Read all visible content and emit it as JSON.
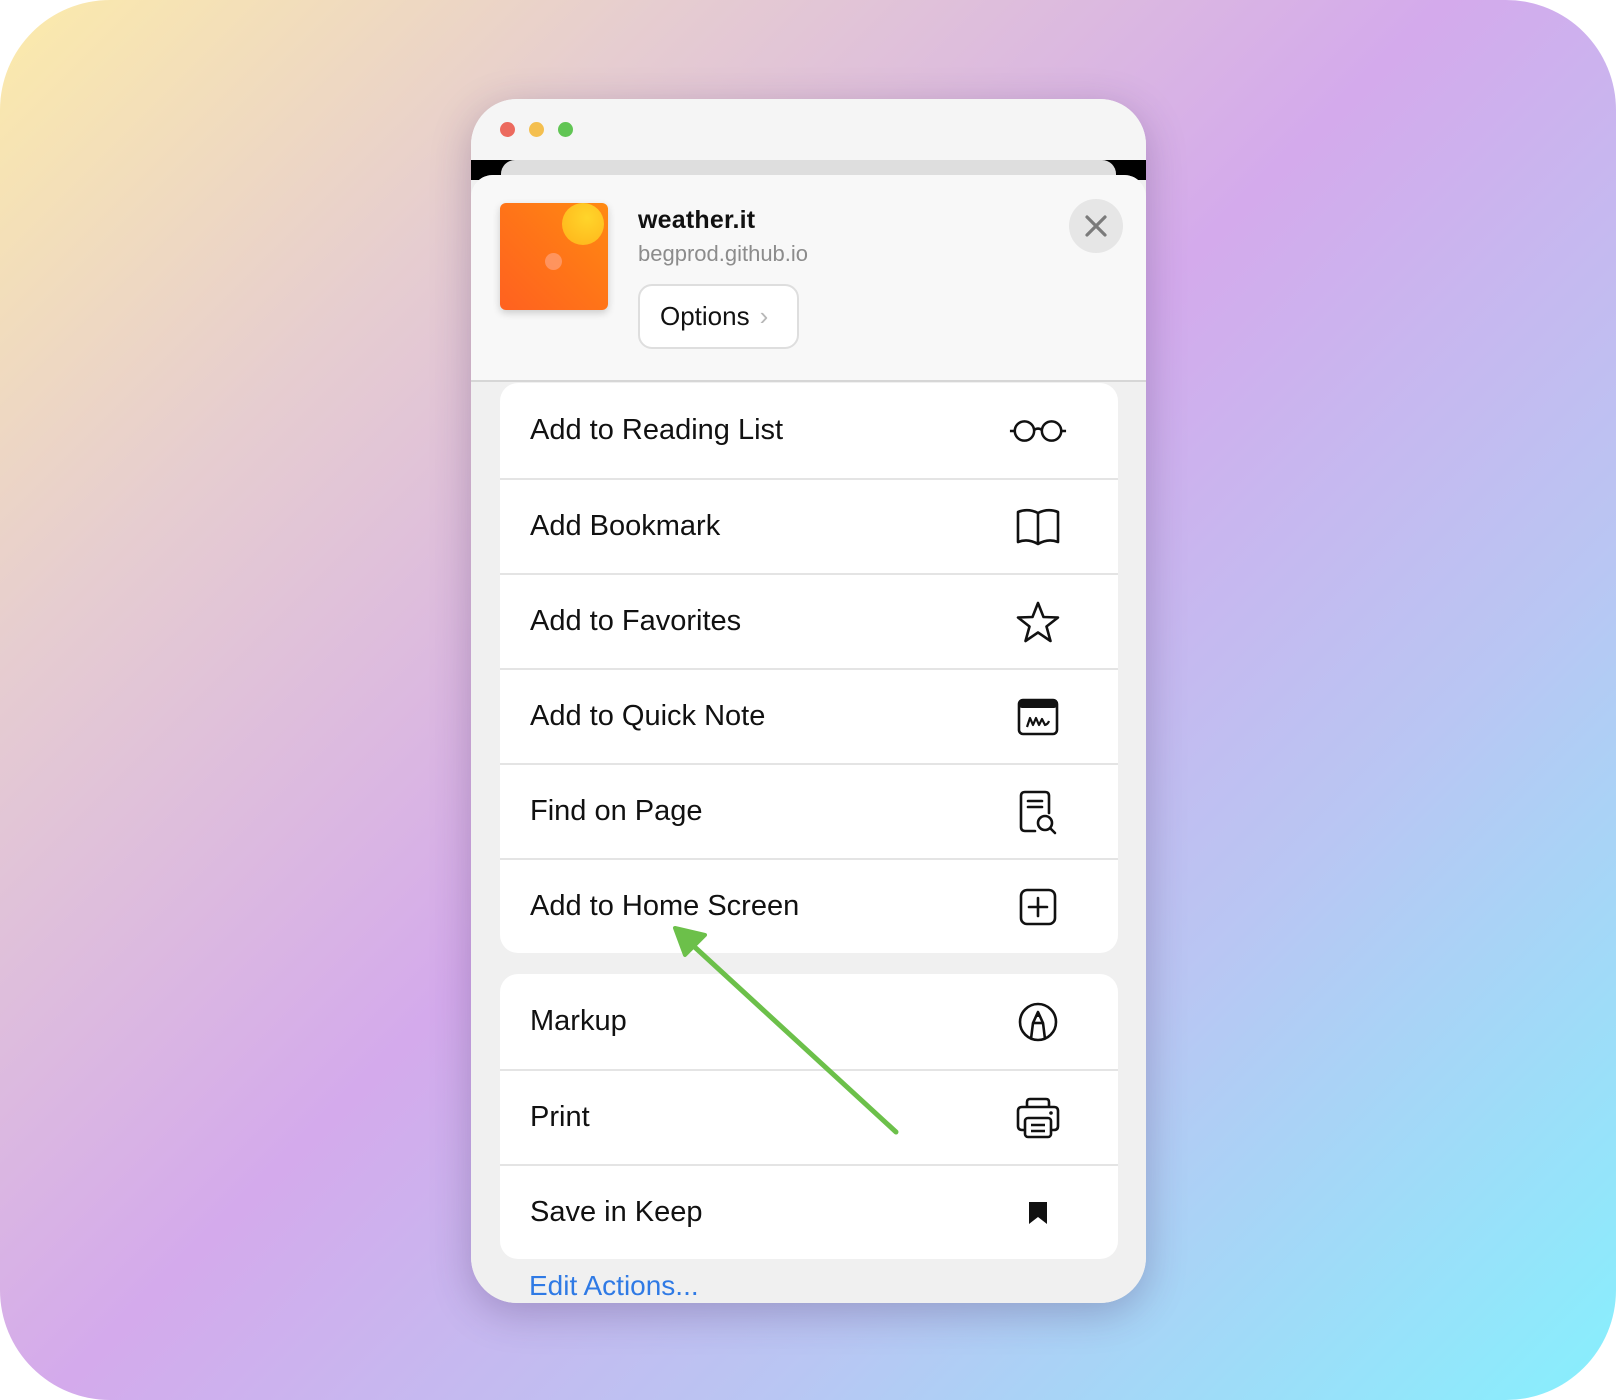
{
  "window": {
    "controls": [
      "close",
      "minimize",
      "zoom"
    ]
  },
  "share_sheet": {
    "app_icon": "weather-app-icon",
    "title": "weather.it",
    "subtitle": "begprod.github.io",
    "options_label": "Options",
    "options_chevron": "›",
    "close_icon": "close-icon"
  },
  "groups": [
    {
      "items": [
        {
          "label": "Add to Reading List",
          "icon": "glasses-icon"
        },
        {
          "label": "Add Bookmark",
          "icon": "book-icon"
        },
        {
          "label": "Add to Favorites",
          "icon": "star-icon"
        },
        {
          "label": "Add to Quick Note",
          "icon": "quick-note-icon"
        },
        {
          "label": "Find on Page",
          "icon": "find-on-page-icon"
        },
        {
          "label": "Add to Home Screen",
          "icon": "add-square-icon"
        }
      ]
    },
    {
      "items": [
        {
          "label": "Markup",
          "icon": "markup-icon"
        },
        {
          "label": "Print",
          "icon": "printer-icon"
        },
        {
          "label": "Save in Keep",
          "icon": "bookmark-icon"
        }
      ]
    }
  ],
  "edit_actions_label": "Edit Actions...",
  "annotation": {
    "type": "arrow",
    "color": "#6cc04a",
    "points_to": "Add to Home Screen"
  },
  "colors": {
    "accent_blue": "#2f7ae5",
    "app_icon_orange": "#ff7418",
    "app_icon_sun": "#ffc824"
  }
}
